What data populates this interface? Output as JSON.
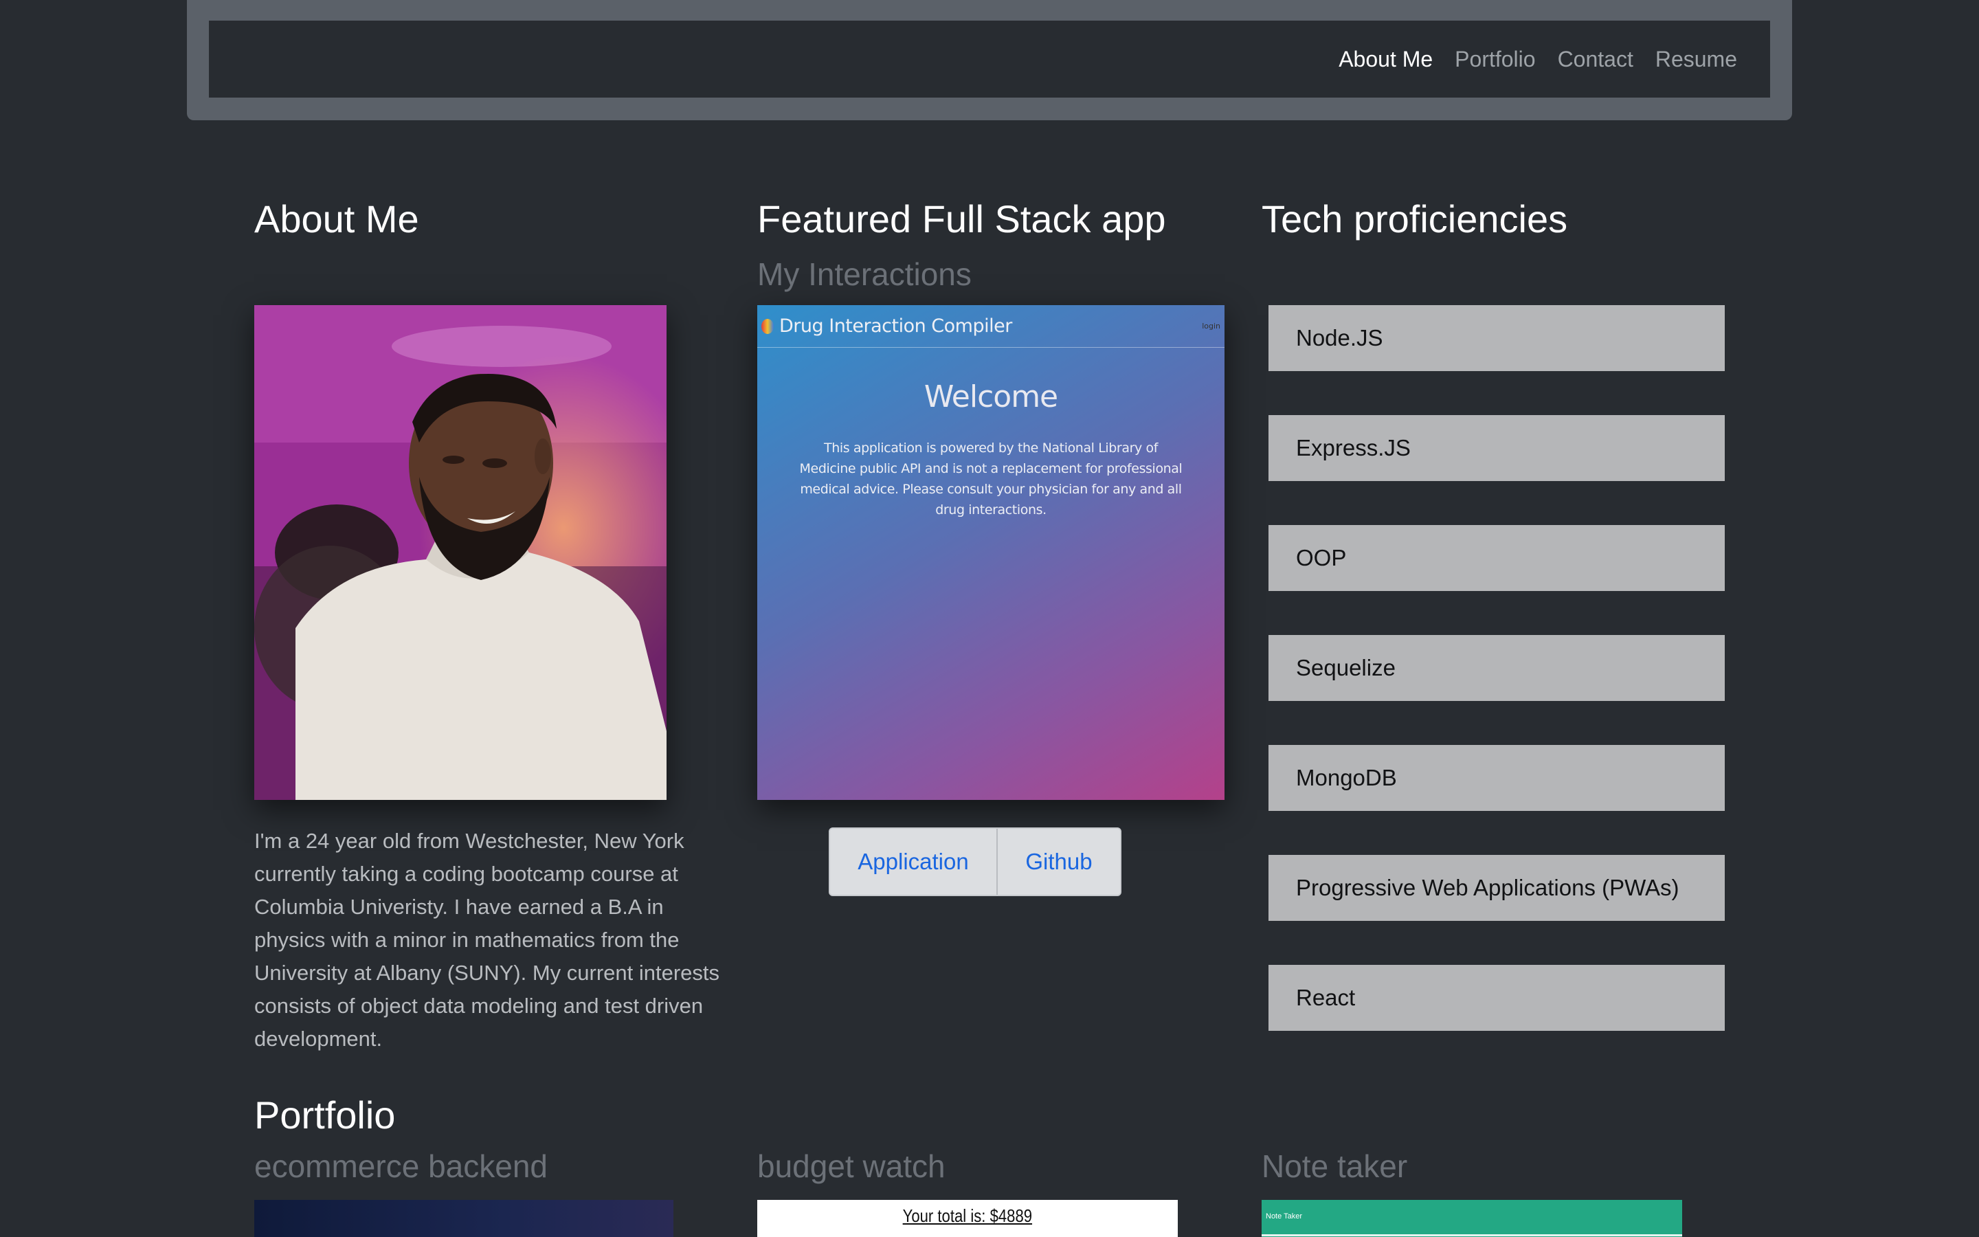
{
  "nav": {
    "links": [
      "About Me",
      "Portfolio",
      "Contact",
      "Resume"
    ],
    "active": "About Me"
  },
  "about": {
    "heading": "About Me",
    "bio": "I'm a 24 year old from Westchester, New York currently taking a coding bootcamp course at Columbia Univeristy. I have earned a B.A in physics with a minor in mathematics from the University at Albany (SUNY). My current interests consists of object data modeling and test driven development."
  },
  "featured": {
    "heading": "Featured Full Stack app",
    "subheading": "My Interactions",
    "screenshot": {
      "app_title": "Drug Interaction Compiler",
      "login": "login",
      "welcome": "Welcome",
      "description": "This application is powered by the National Library of Medicine public API and is not a replacement for professional medical advice. Please consult your physician for any and all drug interactions."
    },
    "buttons": {
      "application": "Application",
      "github": "Github"
    }
  },
  "tech": {
    "heading": "Tech proficiencies",
    "items": [
      "Node.JS",
      "Express.JS",
      "OOP",
      "Sequelize",
      "MongoDB",
      "Progressive Web Applications (PWAs)",
      "React"
    ]
  },
  "portfolio": {
    "heading": "Portfolio",
    "projects": [
      {
        "title": "ecommerce backend"
      },
      {
        "title": "budget watch",
        "preview_text": "Your total is: $4889"
      },
      {
        "title": "Note taker",
        "preview_text": "Note Taker"
      }
    ]
  }
}
